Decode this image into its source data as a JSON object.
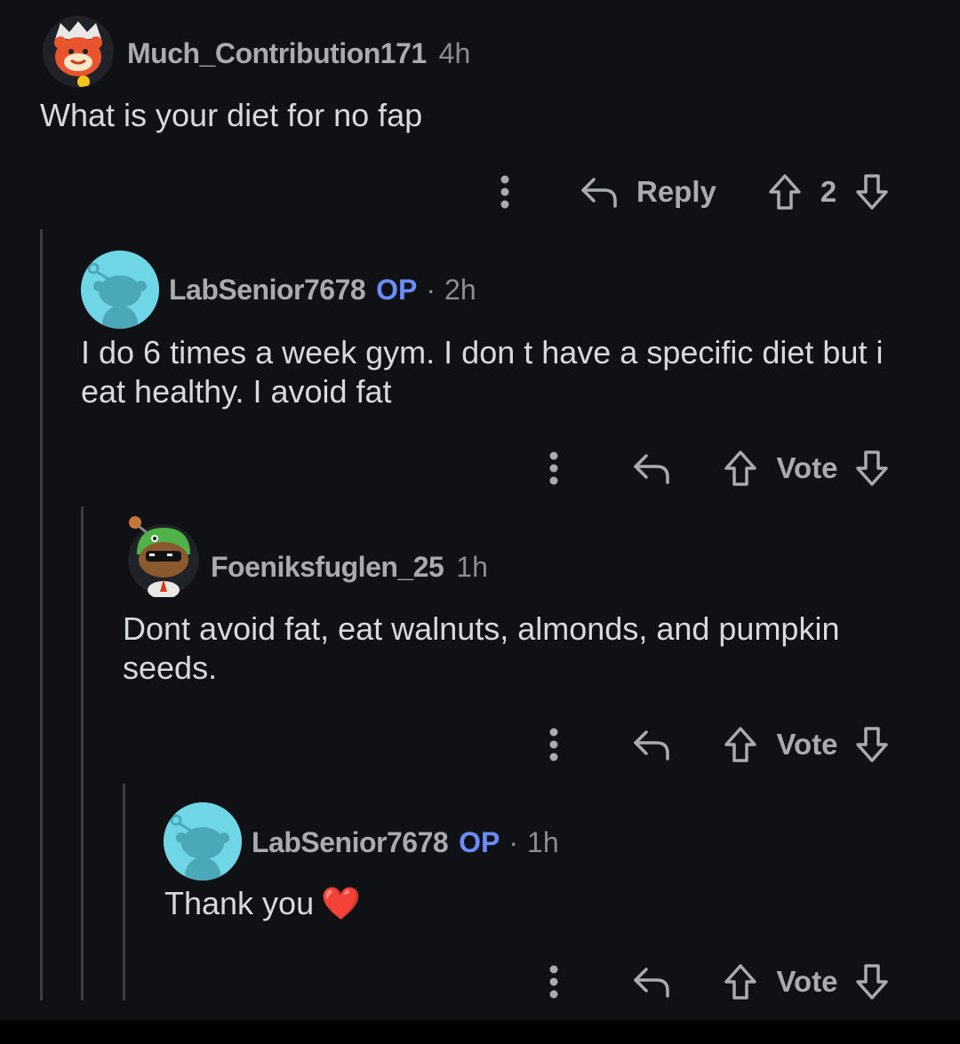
{
  "comments": [
    {
      "username": "Much_Contribution171",
      "time": "4h",
      "body": "What is your diet for no fap",
      "reply_label": "Reply",
      "score": "2",
      "avatar": "snoo-red-viking-avatar"
    },
    {
      "username": "LabSenior7678",
      "op": "OP",
      "dot": "·",
      "time": "2h",
      "body": "I do 6 times a week gym. I don t have a specific diet but i eat healthy. I avoid fat",
      "vote_label": "Vote",
      "avatar": "snoo-default-avatar"
    },
    {
      "username": "Foeniksfuglen_25",
      "time": "1h",
      "body": "Dont avoid fat, eat walnuts, almonds, and pumpkin seeds.",
      "vote_label": "Vote",
      "avatar": "snoo-green-hat-sunglasses-avatar"
    },
    {
      "username": "LabSenior7678",
      "op": "OP",
      "dot": "·",
      "time": "1h",
      "body": "Thank you",
      "emoji": "❤️",
      "vote_label": "Vote",
      "avatar": "snoo-default-avatar"
    }
  ],
  "colors": {
    "background": "#0f1114",
    "op_badge": "#6b8cff",
    "thread_line": "#3a3d41",
    "avatar_teal": "#6fd6e6"
  }
}
